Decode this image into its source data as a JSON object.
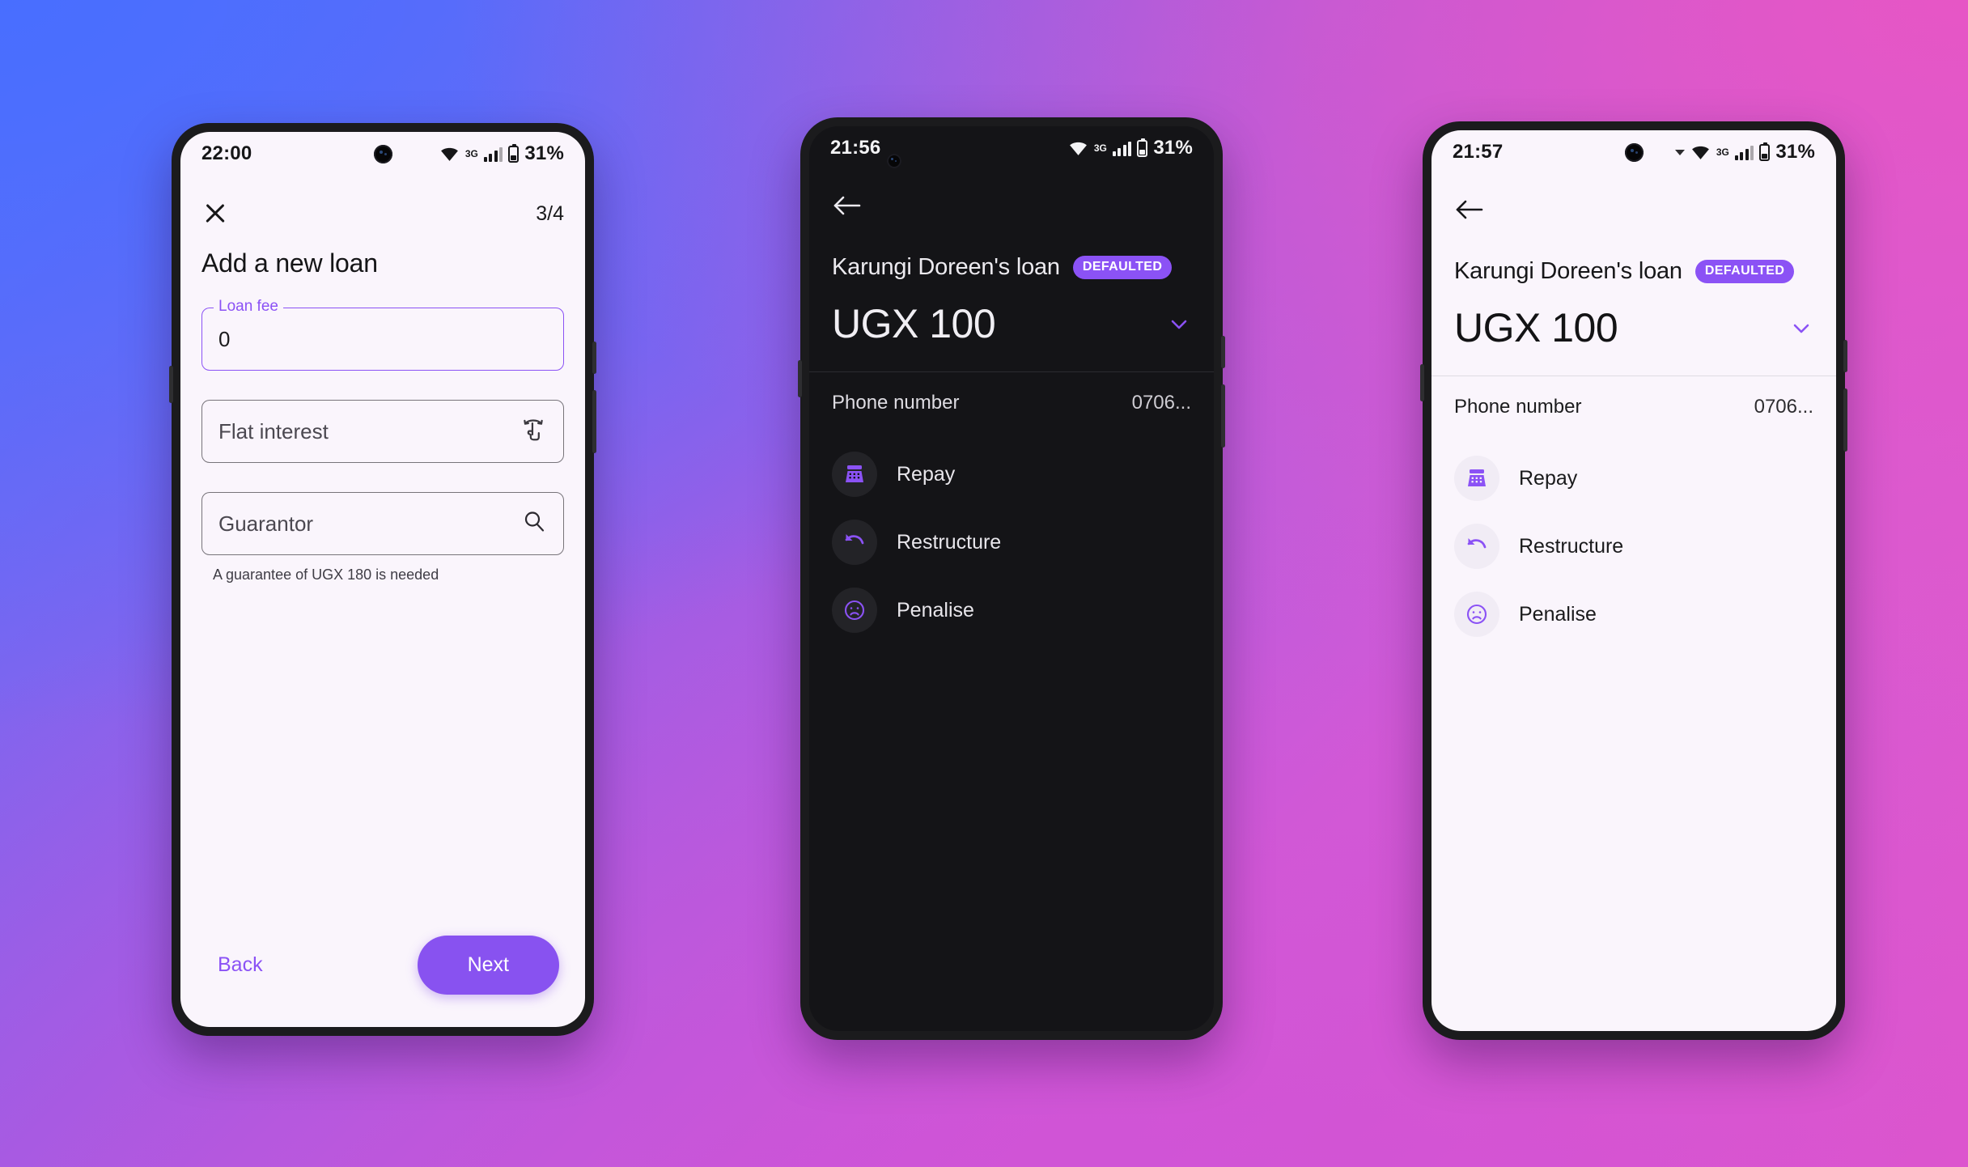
{
  "background": {
    "from": "#5a6ffb",
    "via": "#9a5ee6",
    "to": "#e558c8"
  },
  "accent": "#8b52f5",
  "phone1": {
    "status": {
      "time": "22:00",
      "network": "3G",
      "battery": "31%"
    },
    "close_label": "✕",
    "step": "3/4",
    "title": "Add a new loan",
    "fields": [
      {
        "label": "Loan fee",
        "value": "0",
        "icon": ""
      },
      {
        "label": "",
        "placeholder": "Flat interest",
        "icon": "swap-interest-icon"
      },
      {
        "label": "",
        "placeholder": "Guarantor",
        "icon": "search-icon"
      }
    ],
    "hint": "A guarantee of UGX 180 is needed",
    "back_label": "Back",
    "next_label": "Next"
  },
  "phone2": {
    "status": {
      "time": "21:56",
      "network": "3G",
      "battery": "31%"
    },
    "title": "Karungi Doreen's loan",
    "badge": "DEFAULTED",
    "amount": "UGX 100",
    "detail_rows": [
      {
        "key": "Phone number",
        "value": "0706..."
      }
    ],
    "actions": [
      {
        "label": "Repay",
        "icon": "cash-register-icon"
      },
      {
        "label": "Restructure",
        "icon": "undo-arrow-icon"
      },
      {
        "label": "Penalise",
        "icon": "sad-face-icon"
      }
    ]
  },
  "phone3": {
    "status": {
      "time": "21:57",
      "network": "3G",
      "battery": "31%"
    },
    "title": "Karungi Doreen's loan",
    "badge": "DEFAULTED",
    "amount": "UGX 100",
    "detail_rows": [
      {
        "key": "Phone number",
        "value": "0706..."
      }
    ],
    "actions": [
      {
        "label": "Repay",
        "icon": "cash-register-icon"
      },
      {
        "label": "Restructure",
        "icon": "undo-arrow-icon"
      },
      {
        "label": "Penalise",
        "icon": "sad-face-icon"
      }
    ]
  }
}
